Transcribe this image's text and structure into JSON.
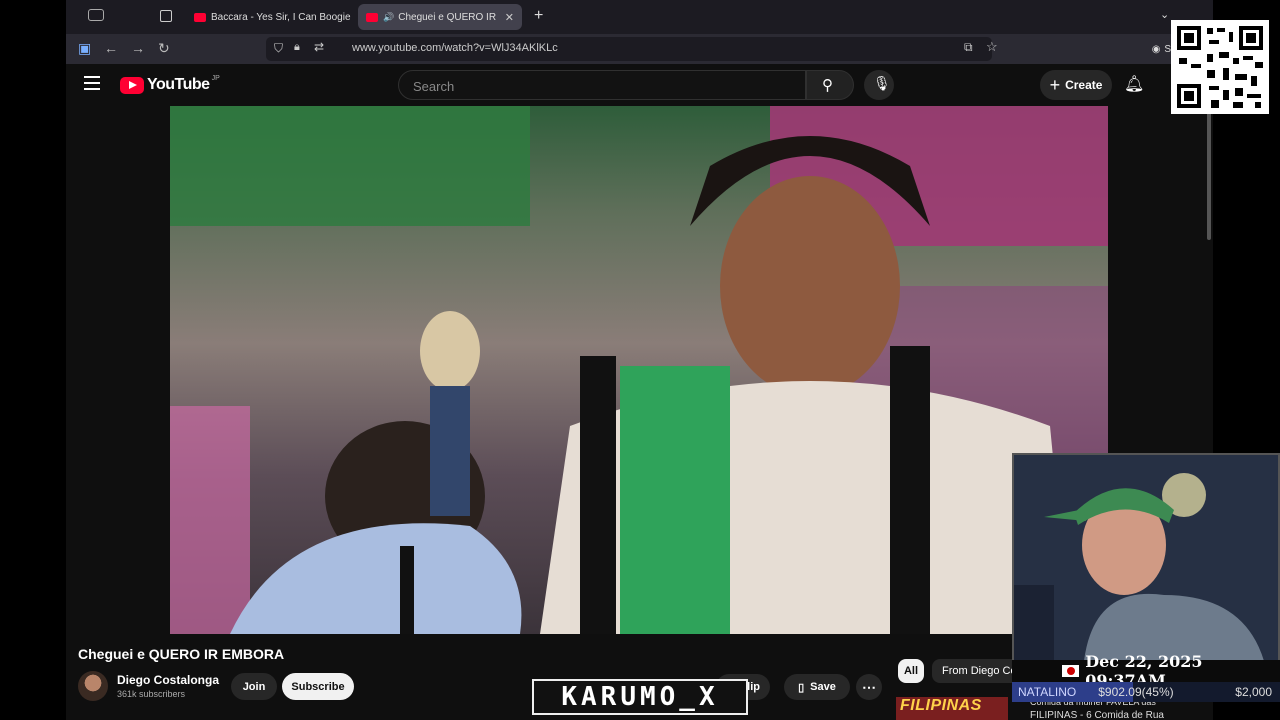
{
  "browser": {
    "tabs": [
      {
        "title": "Baccara - Yes Sir, I Can Boogie",
        "active": false
      },
      {
        "title": "Cheguei e QUERO IR EMBORA",
        "active": true
      }
    ],
    "url": "www.youtube.com/watch?v=WlJ34AKlKLc",
    "signin_label": "Sign in"
  },
  "youtube": {
    "logo_text": "YouTube",
    "logo_region": "JP",
    "search_placeholder": "Search",
    "create_label": "Create"
  },
  "video": {
    "title": "Cheguei e QUERO IR EMBORA",
    "channel": "Diego Costalonga",
    "subscribers": "361k subscribers",
    "join_label": "Join",
    "subscribe_label": "Subscribe",
    "clip_label": "Clip",
    "save_label": "Save"
  },
  "sidebar": {
    "chips": [
      "All",
      "From Diego Co"
    ],
    "rec_thumb_text": "FILIPINAS",
    "rec_title_line1": "Comida da mulher FAVELA das",
    "rec_title_line2": "FILIPINAS - 6 Comida de Rua"
  },
  "overlay": {
    "date": "Dec 22, 2025 09:37AM",
    "donor": "NATALINO",
    "donation_amount": "$902.09(45%)",
    "donation_goal": "$2,000",
    "donation_progress": 0.45,
    "watermark": "KARUMO_X"
  },
  "colors": {
    "brand_red": "#ff0033",
    "progress_blue": "#2d3e8a"
  }
}
